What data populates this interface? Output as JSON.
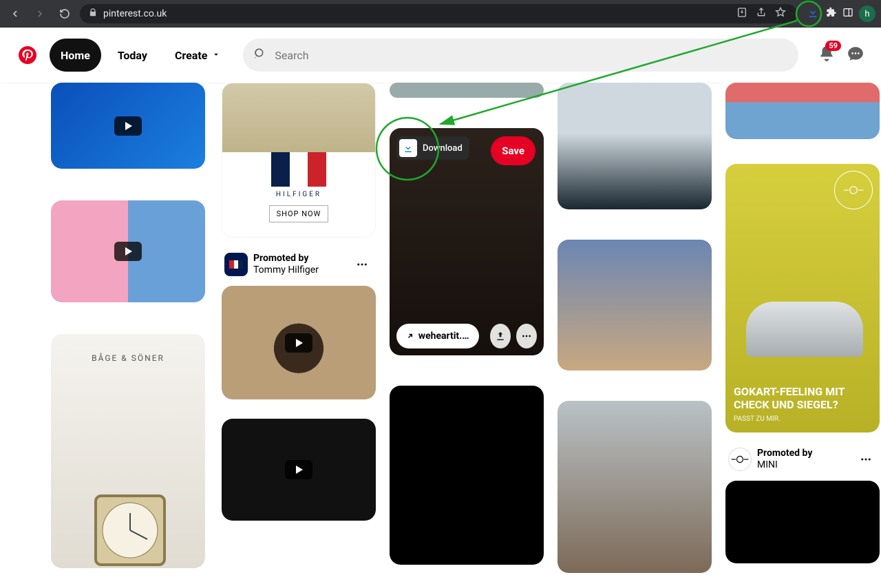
{
  "browser": {
    "url_host": "pinterest.co.uk",
    "profile_letter": "h"
  },
  "header": {
    "nav": {
      "home": "Home",
      "today": "Today",
      "create": "Create"
    },
    "search_placeholder": "Search",
    "notification_count": "59"
  },
  "hovered_pin": {
    "download_label": "Download",
    "save_label": "Save",
    "source_link": "weheartit...."
  },
  "promos": {
    "tommy": {
      "line1": "Promoted by",
      "line2": "Tommy Hilfiger",
      "brand_text": "HILFIGER",
      "shop_now": "SHOP NOW"
    },
    "mini": {
      "line1": "Promoted by",
      "line2": "MINI",
      "headline1": "GOKART-FEELING MIT",
      "headline2": "CHECK UND SIEGEL?",
      "sub": "PASST ZU MIR."
    },
    "bage_brand": "BÅGE & SÖNER"
  }
}
